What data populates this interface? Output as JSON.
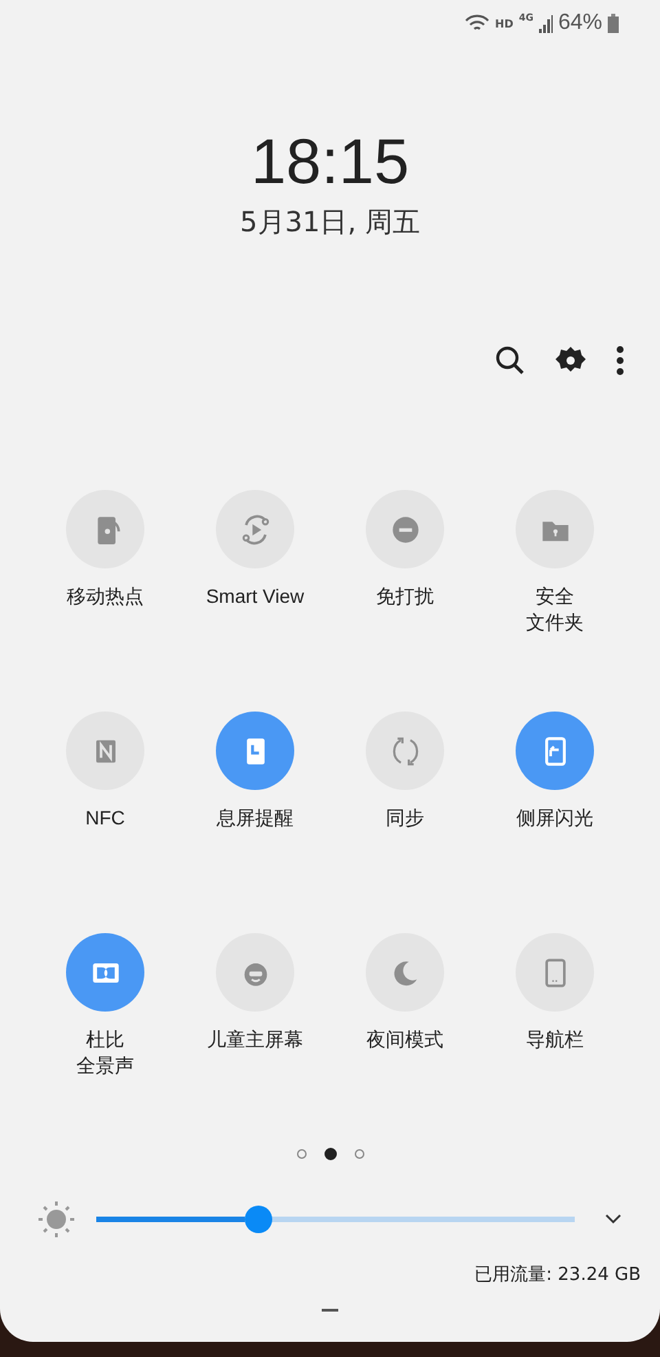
{
  "status_bar": {
    "network": "4G",
    "hd": "HD",
    "battery": "64%"
  },
  "clock": {
    "time": "18:15",
    "date": "5月31日, 周五"
  },
  "tiles": [
    {
      "label": "移动热点",
      "on": false
    },
    {
      "label": "Smart View",
      "on": false
    },
    {
      "label": "免打扰",
      "on": false
    },
    {
      "label": [
        "安全",
        "文件夹"
      ],
      "on": false
    },
    {
      "label": "NFC",
      "on": false
    },
    {
      "label": "息屏提醒",
      "on": true
    },
    {
      "label": "同步",
      "on": false
    },
    {
      "label": "侧屏闪光",
      "on": true
    },
    {
      "label": [
        "杜比",
        "全景声"
      ],
      "on": true
    },
    {
      "label": "儿童主屏幕",
      "on": false
    },
    {
      "label": "夜间模式",
      "on": false
    },
    {
      "label": "导航栏",
      "on": false
    }
  ],
  "pages": [
    {
      "selected": false
    },
    {
      "selected": true
    },
    {
      "selected": false
    }
  ],
  "brightness": {
    "level": 0.34
  },
  "data_usage": "已用流量: 23.24 GB"
}
